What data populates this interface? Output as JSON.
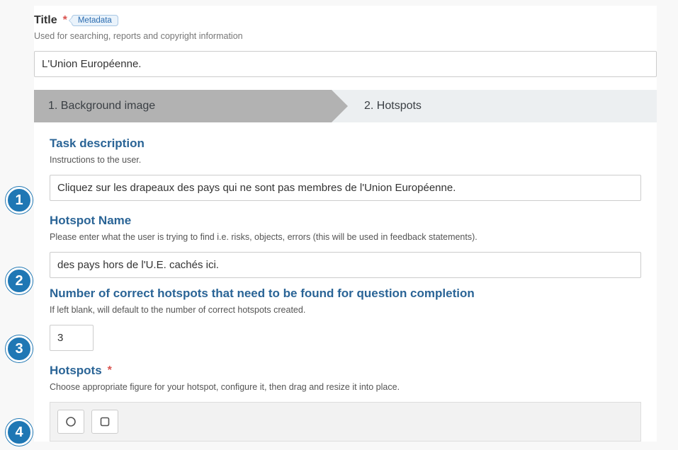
{
  "title": {
    "label": "Title",
    "required_mark": "*",
    "metadata_badge": "Metadata",
    "hint": "Used for searching, reports and copyright information",
    "value": "L'Union Européenne."
  },
  "wizard": {
    "step1": "1. Background image",
    "step2": "2. Hotspots"
  },
  "task_description": {
    "label": "Task description",
    "hint": "Instructions to the user.",
    "value": "Cliquez sur les drapeaux des pays qui ne sont pas membres de l'Union Européenne."
  },
  "hotspot_name": {
    "label": "Hotspot Name",
    "hint": "Please enter what the user is trying to find i.e. risks, objects, errors (this will be used in feedback statements).",
    "value": "des pays hors de l'U.E. cachés ici."
  },
  "num_correct": {
    "label": "Number of correct hotspots that need to be found for question completion",
    "hint": "If left blank, will default to the number of correct hotspots created.",
    "value": "3"
  },
  "hotspots": {
    "label": "Hotspots",
    "required_mark": "*",
    "hint": "Choose appropriate figure for your hotspot, configure it, then drag and resize it into place."
  },
  "annotations": {
    "a1": "1",
    "a2": "2",
    "a3": "3",
    "a4": "4"
  }
}
